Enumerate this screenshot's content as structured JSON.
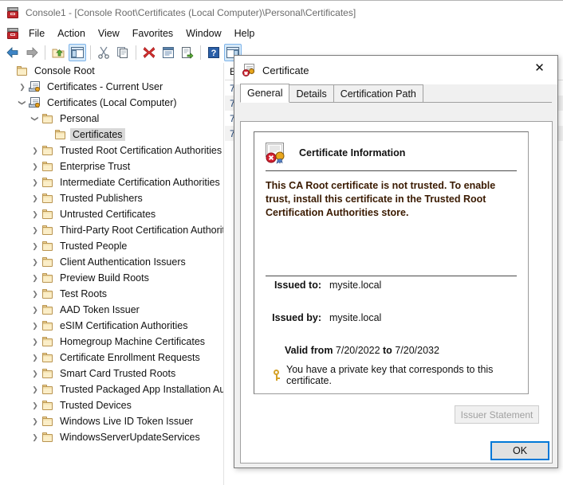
{
  "window": {
    "title": "Console1 - [Console Root\\Certificates (Local Computer)\\Personal\\Certificates]",
    "icon": "mmc-console-icon"
  },
  "menu": {
    "items": [
      {
        "label": "File"
      },
      {
        "label": "Action"
      },
      {
        "label": "View"
      },
      {
        "label": "Favorites"
      },
      {
        "label": "Window"
      },
      {
        "label": "Help"
      }
    ]
  },
  "toolbar": {
    "buttons": [
      {
        "name": "back-button",
        "icon": "arrow-left-icon",
        "glyph": "⇦",
        "color": "#3d7fc1",
        "active": false
      },
      {
        "name": "forward-button",
        "icon": "arrow-right-icon",
        "glyph": "⇨",
        "color": "#9a9a9a",
        "active": false
      },
      {
        "name": "up-one-level-button",
        "icon": "folder-up-icon",
        "glyph": "▲",
        "color": "#4f9a2f",
        "active": false
      },
      {
        "name": "show-tree-button",
        "icon": "console-tree-icon",
        "glyph": "▤",
        "color": "#3f6fa8",
        "active": true
      },
      {
        "name": "cut-button",
        "icon": "scissors-icon",
        "glyph": "✂",
        "color": "#5a5a5a",
        "active": false
      },
      {
        "name": "copy-button",
        "icon": "copy-icon",
        "glyph": "❐",
        "color": "#6e7d8c",
        "active": false
      },
      {
        "name": "delete-button",
        "icon": "delete-x-icon",
        "glyph": "✖",
        "color": "#cc2027",
        "active": false
      },
      {
        "name": "properties-button",
        "icon": "properties-icon",
        "glyph": "▤",
        "color": "#4f6f8f",
        "active": false
      },
      {
        "name": "export-button",
        "icon": "export-icon",
        "glyph": "➥",
        "color": "#4f9a2f",
        "active": false
      },
      {
        "name": "help-button",
        "icon": "help-question-icon",
        "glyph": "?",
        "color": "#ffffff",
        "active": false
      },
      {
        "name": "show-action-pane-button",
        "icon": "action-pane-icon",
        "glyph": "▤",
        "color": "#3f6fa8",
        "active": true
      }
    ]
  },
  "tree": {
    "items": [
      {
        "label": "Console Root",
        "indent": 0,
        "twisty": "",
        "icon": "folder-icon",
        "selected": false
      },
      {
        "label": "Certificates - Current User",
        "indent": 1,
        "twisty": "❯",
        "icon": "snapin-icon",
        "selected": false
      },
      {
        "label": "Certificates (Local Computer)",
        "indent": 1,
        "twisty": "❯",
        "expanded": true,
        "icon": "snapin-icon",
        "selected": false
      },
      {
        "label": "Personal",
        "indent": 2,
        "twisty": "❯",
        "expanded": true,
        "icon": "folder-icon",
        "selected": false
      },
      {
        "label": "Certificates",
        "indent": 3,
        "twisty": "",
        "icon": "folder-icon",
        "selected": true
      },
      {
        "label": "Trusted Root Certification Authorities",
        "indent": 2,
        "twisty": "❯",
        "icon": "folder-icon",
        "selected": false
      },
      {
        "label": "Enterprise Trust",
        "indent": 2,
        "twisty": "❯",
        "icon": "folder-icon",
        "selected": false
      },
      {
        "label": "Intermediate Certification Authorities",
        "indent": 2,
        "twisty": "❯",
        "icon": "folder-icon",
        "selected": false
      },
      {
        "label": "Trusted Publishers",
        "indent": 2,
        "twisty": "❯",
        "icon": "folder-icon",
        "selected": false
      },
      {
        "label": "Untrusted Certificates",
        "indent": 2,
        "twisty": "❯",
        "icon": "folder-icon",
        "selected": false
      },
      {
        "label": "Third-Party Root Certification Authorities",
        "indent": 2,
        "twisty": "❯",
        "icon": "folder-icon",
        "selected": false
      },
      {
        "label": "Trusted People",
        "indent": 2,
        "twisty": "❯",
        "icon": "folder-icon",
        "selected": false
      },
      {
        "label": "Client Authentication Issuers",
        "indent": 2,
        "twisty": "❯",
        "icon": "folder-icon",
        "selected": false
      },
      {
        "label": "Preview Build Roots",
        "indent": 2,
        "twisty": "❯",
        "icon": "folder-icon",
        "selected": false
      },
      {
        "label": "Test Roots",
        "indent": 2,
        "twisty": "❯",
        "icon": "folder-icon",
        "selected": false
      },
      {
        "label": "AAD Token Issuer",
        "indent": 2,
        "twisty": "❯",
        "icon": "folder-icon",
        "selected": false
      },
      {
        "label": "eSIM Certification Authorities",
        "indent": 2,
        "twisty": "❯",
        "icon": "folder-icon",
        "selected": false
      },
      {
        "label": "Homegroup Machine Certificates",
        "indent": 2,
        "twisty": "❯",
        "icon": "folder-icon",
        "selected": false
      },
      {
        "label": "Certificate Enrollment Requests",
        "indent": 2,
        "twisty": "❯",
        "icon": "folder-icon",
        "selected": false
      },
      {
        "label": "Smart Card Trusted Roots",
        "indent": 2,
        "twisty": "❯",
        "icon": "folder-icon",
        "selected": false
      },
      {
        "label": "Trusted Packaged App Installation Authorit",
        "indent": 2,
        "twisty": "❯",
        "icon": "folder-icon",
        "selected": false
      },
      {
        "label": "Trusted Devices",
        "indent": 2,
        "twisty": "❯",
        "icon": "folder-icon",
        "selected": false
      },
      {
        "label": "Windows Live ID Token Issuer",
        "indent": 2,
        "twisty": "❯",
        "icon": "folder-icon",
        "selected": false
      },
      {
        "label": "WindowsServerUpdateServices",
        "indent": 2,
        "twisty": "❯",
        "icon": "folder-icon",
        "selected": false
      }
    ]
  },
  "list": {
    "header": "E",
    "rows": [
      "7",
      "7",
      "7",
      "7"
    ]
  },
  "dialog": {
    "title": "Certificate",
    "icon": "certificate-error-icon",
    "close_label": "✕",
    "tabs": [
      {
        "label": "General",
        "selected": true
      },
      {
        "label": "Details",
        "selected": false
      },
      {
        "label": "Certification Path",
        "selected": false
      }
    ],
    "info_heading": "Certificate Information",
    "warning": "This CA Root certificate is not trusted. To enable trust, install this certificate in the Trusted Root Certification Authorities store.",
    "fields": [
      {
        "label": "Issued to:",
        "value": "mysite.local"
      },
      {
        "label": "Issued by:",
        "value": "mysite.local"
      }
    ],
    "valid": {
      "from_label": "Valid from",
      "from_value": "7/20/2022",
      "to_label": "to",
      "to_value": "7/20/2032"
    },
    "private_key_note": "You have a private key that corresponds to this certificate.",
    "issuer_statement_label": "Issuer Statement",
    "ok_label": "OK",
    "accent_color": "#0078d7"
  }
}
